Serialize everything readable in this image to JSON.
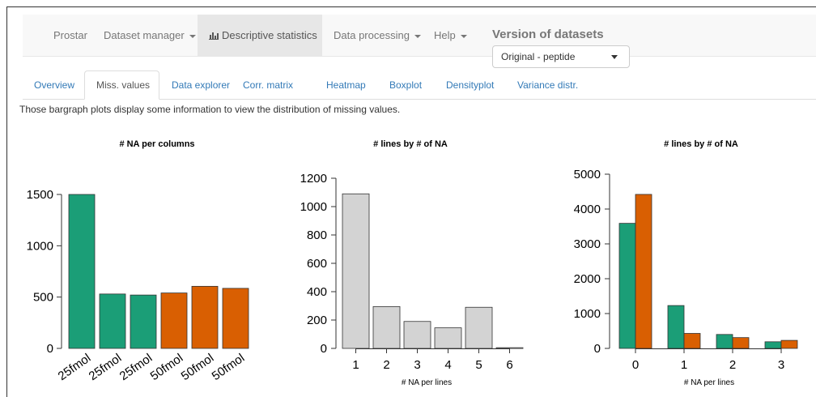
{
  "navbar": {
    "items": [
      {
        "label": "Prostar",
        "dropdown": false,
        "active": false
      },
      {
        "label": "Dataset manager",
        "dropdown": true,
        "active": false
      },
      {
        "label": "Descriptive statistics",
        "dropdown": false,
        "active": true,
        "icon": "bar-chart-icon"
      },
      {
        "label": "Data processing",
        "dropdown": true,
        "active": false
      },
      {
        "label": "Help",
        "dropdown": true,
        "active": false
      }
    ],
    "version_title": "Version of datasets",
    "version_selected": "Original - peptide"
  },
  "tabs": [
    "Overview",
    "Miss. values",
    "Data explorer",
    "Corr. matrix",
    "Heatmap",
    "Boxplot",
    "Densityplot",
    "Variance distr."
  ],
  "active_tab": "Miss. values",
  "description": "Those bargraph plots display some information to view the distribution of missing values.",
  "colors": {
    "green": "#1b9e77",
    "orange": "#d95f02",
    "grey": "#d3d3d3",
    "link": "#337ab7"
  },
  "chart_data": [
    {
      "type": "bar",
      "title": "# NA per columns",
      "categories": [
        "25fmol",
        "25fmol",
        "25fmol",
        "50fmol",
        "50fmol",
        "50fmol"
      ],
      "values": [
        1500,
        530,
        520,
        540,
        605,
        585
      ],
      "bar_colors": [
        "#1b9e77",
        "#1b9e77",
        "#1b9e77",
        "#d95f02",
        "#d95f02",
        "#d95f02"
      ],
      "yticks": [
        0,
        500,
        1000,
        1500
      ],
      "ylim": [
        0,
        1500
      ],
      "xlabel": ""
    },
    {
      "type": "bar",
      "title": "# lines by # of NA",
      "categories": [
        "1",
        "2",
        "3",
        "4",
        "5",
        "6"
      ],
      "values": [
        1090,
        295,
        190,
        145,
        290,
        5
      ],
      "bar_color": "#d3d3d3",
      "yticks": [
        0,
        200,
        400,
        600,
        800,
        1000,
        1200
      ],
      "ylim": [
        0,
        1200
      ],
      "xlabel": "# NA per lines"
    },
    {
      "type": "bar",
      "title": "# lines by # of NA",
      "categories": [
        "0",
        "1",
        "2",
        "3"
      ],
      "series": [
        {
          "values": [
            3590,
            1230,
            400,
            190
          ],
          "color": "#1b9e77"
        },
        {
          "values": [
            4420,
            430,
            310,
            230
          ],
          "color": "#d95f02"
        }
      ],
      "yticks": [
        0,
        1000,
        2000,
        3000,
        4000,
        5000
      ],
      "ylim": [
        0,
        5000
      ],
      "xlabel": "# NA per lines"
    }
  ]
}
